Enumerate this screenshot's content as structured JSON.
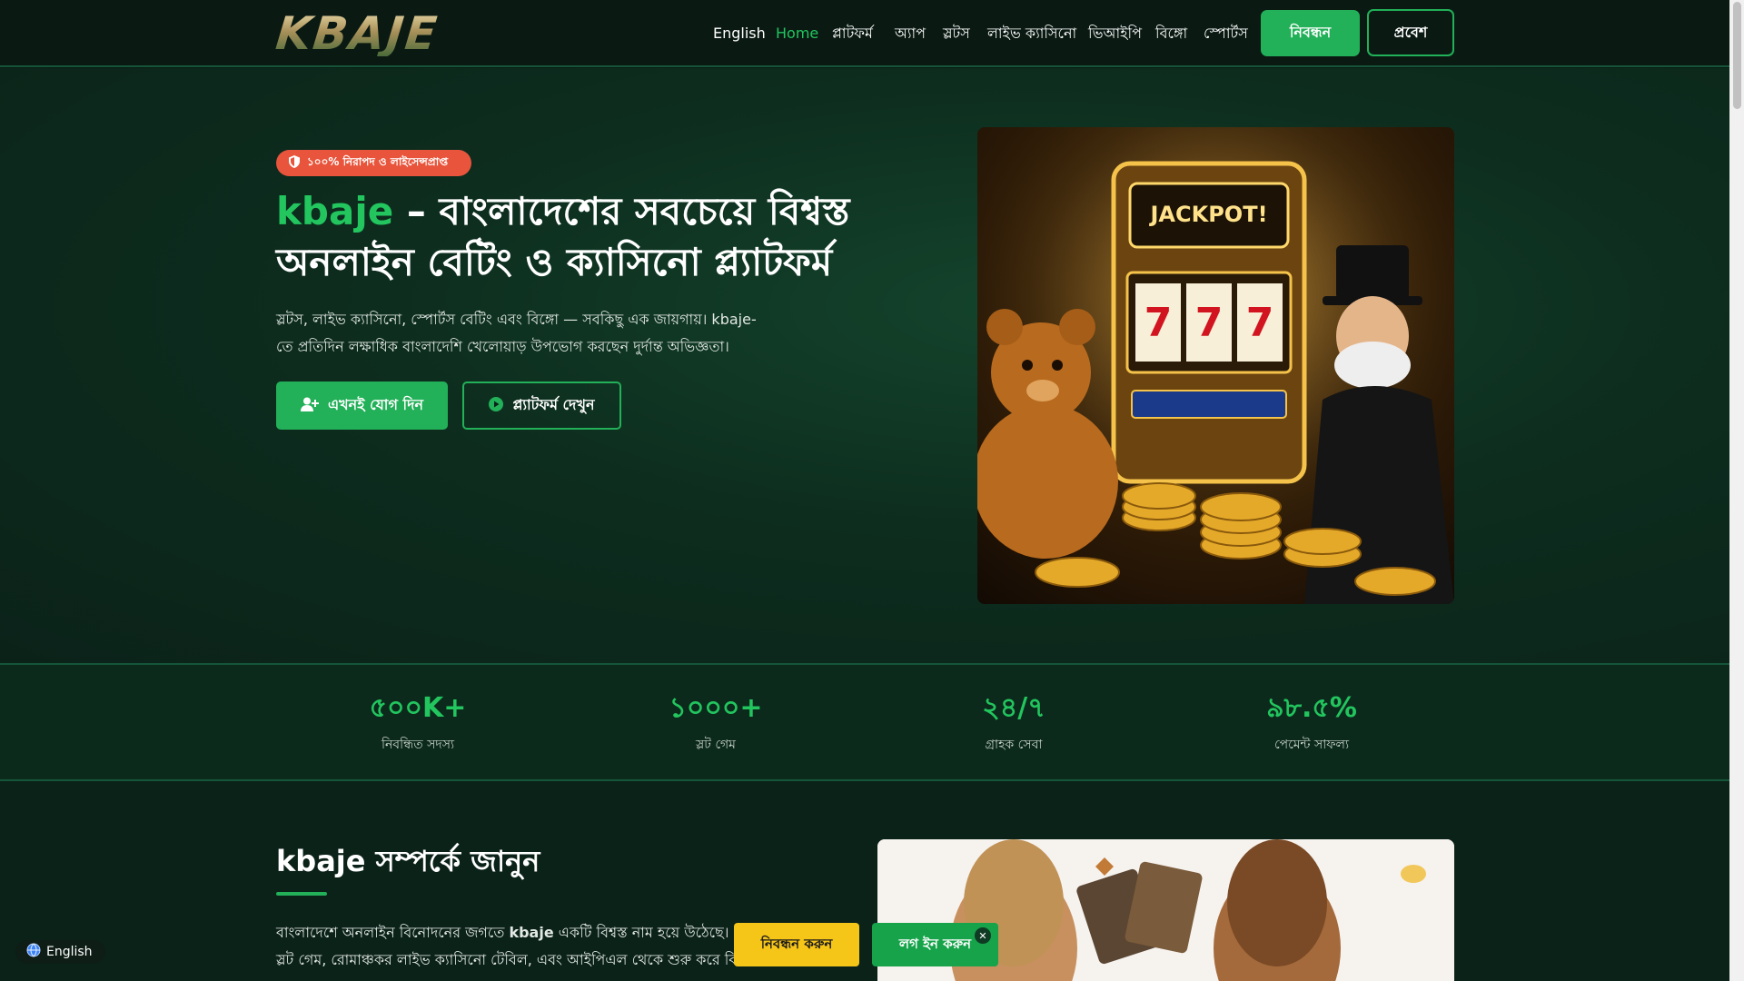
{
  "header": {
    "logo_text": "KBAJE",
    "nav": [
      {
        "label": "English",
        "active": false
      },
      {
        "label": "Home",
        "active": true
      },
      {
        "label": "প্লাটফর্ম",
        "active": false
      },
      {
        "label": "অ্যাপ",
        "active": false
      },
      {
        "label": "স্লটস",
        "active": false
      },
      {
        "label": "লাইভ ক্যাসিনো",
        "active": false
      },
      {
        "label": "ভিআইপি",
        "active": false
      },
      {
        "label": "বিঙ্গো",
        "active": false
      },
      {
        "label": "স্পোর্টস",
        "active": false
      }
    ],
    "register_label": "নিবন্ধন",
    "login_label": "প্রবেশ"
  },
  "hero": {
    "badge": "১০০% নিরাপদ ও লাইসেন্সপ্রাপ্ত",
    "title_brand": "kbaje",
    "title_rest": " – বাংলাদেশের সবচেয়ে বিশ্বস্ত অনলাইন বেটিং ও ক্যাসিনো প্ল্যাটফর্ম",
    "description": "স্লটস, লাইভ ক্যাসিনো, স্পোর্টস বেটিং এবং বিঙ্গো — সবকিছু এক জায়গায়। kbaje-তে প্রতিদিন লক্ষাধিক বাংলাদেশি খেলোয়াড় উপভোগ করছেন দুর্দান্ত অভিজ্ঞতা।",
    "join_label": "এখনই যোগ দিন",
    "view_label": "প্ল্যাটফর্ম দেখুন",
    "image_text": "JACKPOT!"
  },
  "stats": [
    {
      "value": "৫০০K+",
      "label": "নিবন্ধিত সদস্য"
    },
    {
      "value": "১০০০+",
      "label": "স্লট গেম"
    },
    {
      "value": "২৪/৭",
      "label": "গ্রাহক সেবা"
    },
    {
      "value": "৯৮.৫%",
      "label": "পেমেন্ট সাফল্য"
    }
  ],
  "about": {
    "title": "kbaje সম্পর্কে জানুন",
    "text_line1_pre": "বাংলাদেশে অনলাইন বিনোদনের জগতে ",
    "text_line1_brand": "kbaje",
    "text_line1_post": " একটি বিশ্বস্ত নাম হয়ে উঠেছে। এখানে অ",
    "text_line2": "স্লট গেম, রোমাঞ্চকর লাইভ ক্যাসিনো টেবিল, এবং আইপিএল থেকে শুরু করে বিশ্বকাপ প"
  },
  "floating": {
    "register_label": "নিবন্ধন করুন",
    "login_label": "লগ ইন করুন",
    "close_symbol": "✕"
  },
  "language_pill": {
    "label": "English",
    "icon": "globe-icon"
  },
  "colors": {
    "accent": "#22b058",
    "accent_text": "#22c55e",
    "badge": "#e8553c",
    "float_register": "#f5c518"
  }
}
